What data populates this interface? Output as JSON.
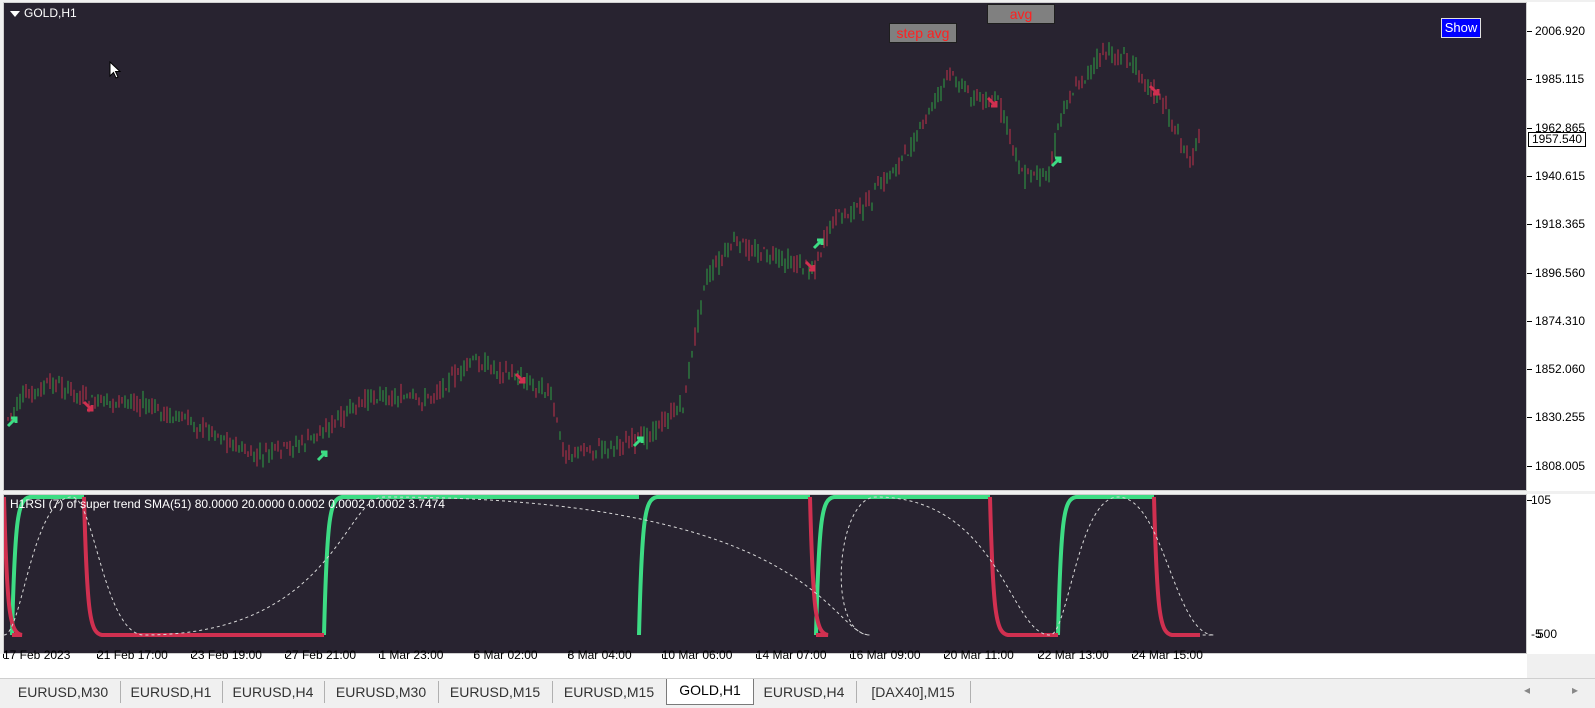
{
  "chart": {
    "title": "GOLD,H1",
    "indicator_title": "H1RSI (7) of super trend SMA(51) 80.0000 20.0000 0.0002 0.0002 0.0002 3.7474",
    "current_price": "1957.540",
    "price_labels": [
      "2006.920",
      "1985.115",
      "1962.865",
      "1940.615",
      "1918.365",
      "1896.560",
      "1874.310",
      "1852.060",
      "1830.255",
      "1808.005"
    ],
    "sub_labels": {
      "top": "105",
      "bottom": "-5",
      "bottom_overlay": "500"
    },
    "time_labels": [
      "17 Feb 2023",
      "21 Feb 17:00",
      "23 Feb 19:00",
      "27 Feb 21:00",
      "1 Mar 23:00",
      "6 Mar 02:00",
      "8 Mar 04:00",
      "10 Mar 06:00",
      "14 Mar 07:00",
      "16 Mar 09:00",
      "20 Mar 11:00",
      "22 Mar 13:00",
      "24 Mar 15:00"
    ],
    "buttons": {
      "step_avg": "step avg",
      "avg": "avg",
      "show": "Show"
    },
    "colors": {
      "background": "#282330",
      "bull": "#2ea043",
      "bear": "#c0304a",
      "indicator_up": "#3ddc84",
      "indicator_down": "#d03050",
      "button_text": "#ff2020",
      "show_bg": "#0000ff"
    },
    "icons": [
      "mouse-cursor-icon",
      "dropdown-triangle-icon",
      "buy-arrow-icon",
      "sell-arrow-icon"
    ]
  },
  "tabs": [
    {
      "label": "EURUSD,M30",
      "active": false
    },
    {
      "label": "EURUSD,H1",
      "active": false
    },
    {
      "label": "EURUSD,H4",
      "active": false
    },
    {
      "label": "EURUSD,M30",
      "active": false
    },
    {
      "label": "EURUSD,M15",
      "active": false
    },
    {
      "label": "EURUSD,M15",
      "active": false
    },
    {
      "label": "GOLD,H1",
      "active": true
    },
    {
      "label": "EURUSD,H4",
      "active": false
    },
    {
      "label": "[DAX40],M15",
      "active": false
    }
  ],
  "tab_nav": {
    "left": "◂",
    "right": "▸"
  }
}
